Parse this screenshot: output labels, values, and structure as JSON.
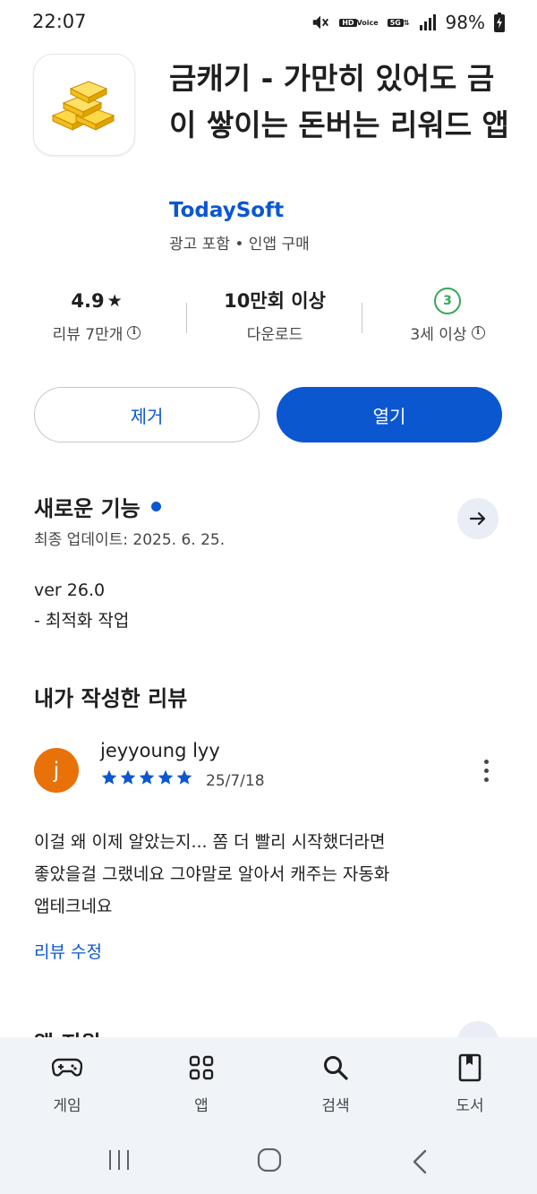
{
  "status_bar": {
    "time": "22:07",
    "battery": "98%",
    "hd_top": "HD",
    "hd_bottom": "Voice",
    "network": "5G"
  },
  "app": {
    "title": "금캐기 - 가만히 있어도 금이 쌓이는 돈버는 리워드 앱",
    "developer": "TodaySoft",
    "meta": "광고 포함 • 인앱 구매",
    "icon": "gold-bars-icon"
  },
  "stats": {
    "rating": "4.9",
    "rating_star": "★",
    "reviews_label": "리뷰 7만개",
    "downloads": "10만회 이상",
    "downloads_label": "다운로드",
    "age_badge": "3",
    "age_label": "3세 이상"
  },
  "buttons": {
    "uninstall": "제거",
    "open": "열기"
  },
  "whats_new": {
    "title": "새로운 기능",
    "updated": "최종 업데이트: 2025. 6. 25.",
    "version": "ver 26.0",
    "note": "- 최적화 작업"
  },
  "my_review": {
    "title": "내가 작성한 리뷰",
    "avatar_letter": "j",
    "reviewer": "jeyyoung lyy",
    "rating": 5,
    "date": "25/7/18",
    "text_lines": [
      "이걸 왜 이제 알았는지... 쫌 더 빨리 시작했더라면",
      "좋았을걸 그랬네요 그야말로 알아서 캐주는 자동화",
      "앱테크네요"
    ],
    "edit_label": "리뷰 수정"
  },
  "next_section_title": "앱 지원",
  "bottom_nav": [
    {
      "label": "게임",
      "icon": "gamepad-icon"
    },
    {
      "label": "앱",
      "icon": "apps-grid-icon"
    },
    {
      "label": "검색",
      "icon": "search-icon"
    },
    {
      "label": "도서",
      "icon": "book-icon"
    }
  ],
  "colors": {
    "accent": "#0b57d0",
    "age_green": "#34a853",
    "avatar": "#e8710a",
    "nav_bg": "#f0f4f9"
  }
}
